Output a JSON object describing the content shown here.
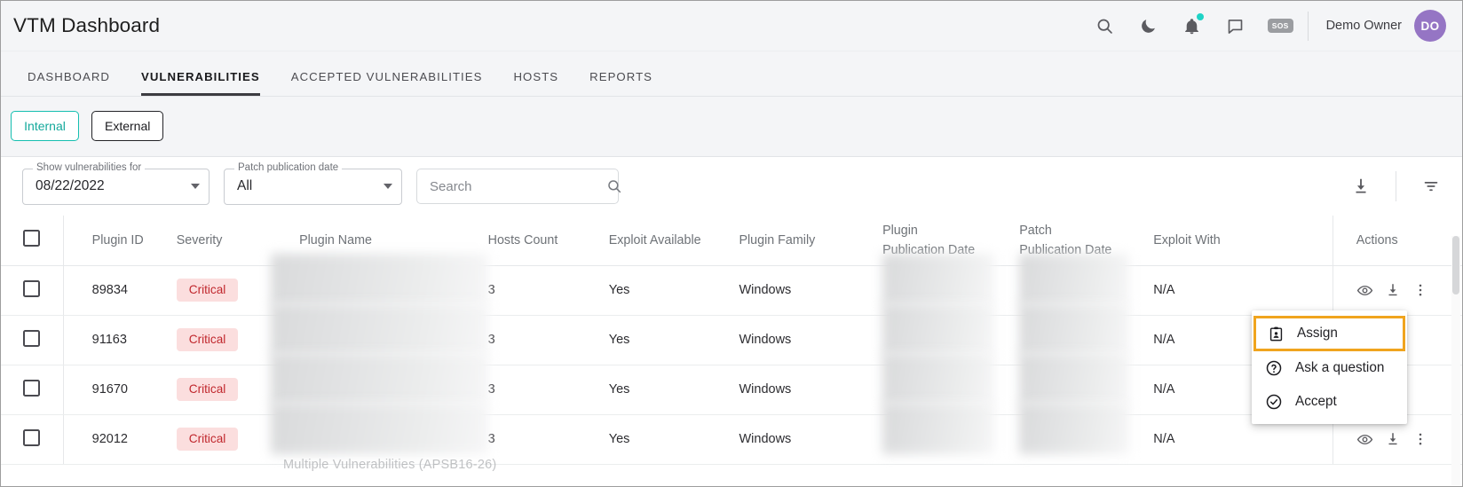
{
  "header": {
    "title": "VTM Dashboard",
    "icons": [
      {
        "name": "search-icon"
      },
      {
        "name": "dark-mode-moon-icon"
      },
      {
        "name": "notifications-bell-icon",
        "badge": true
      },
      {
        "name": "chat-message-icon"
      },
      {
        "name": "sos-icon",
        "label": "SOS"
      }
    ],
    "user_name": "Demo Owner",
    "avatar_initials": "DO",
    "accent_teal": "#1ed3c6",
    "avatar_color": "#9575c4"
  },
  "tabs": [
    {
      "label": "DASHBOARD",
      "active": false
    },
    {
      "label": "VULNERABILITIES",
      "active": true
    },
    {
      "label": "ACCEPTED VULNERABILITIES",
      "active": false
    },
    {
      "label": "HOSTS",
      "active": false
    },
    {
      "label": "REPORTS",
      "active": false
    }
  ],
  "scope": {
    "selected": "Internal",
    "buttons": [
      {
        "label": "Internal",
        "selected": true
      },
      {
        "label": "External",
        "selected": false
      }
    ],
    "selected_color": "#15a99c"
  },
  "filters": {
    "date_filter": {
      "label": "Show vulnerabilities for",
      "value": "08/22/2022"
    },
    "patch_filter": {
      "label": "Patch publication date",
      "value": "All"
    },
    "search": {
      "placeholder": "Search",
      "value": ""
    },
    "download_label": "download-icon",
    "filter_label": "filter-icon"
  },
  "table": {
    "columns": [
      {
        "key": "check",
        "label": ""
      },
      {
        "key": "plugin_id",
        "label": "Plugin ID"
      },
      {
        "key": "severity",
        "label": "Severity"
      },
      {
        "key": "plugin_name",
        "label": "Plugin Name"
      },
      {
        "key": "hosts_count",
        "label": "Hosts Count"
      },
      {
        "key": "exploit_available",
        "label": "Exploit Available"
      },
      {
        "key": "plugin_family",
        "label": "Plugin Family"
      },
      {
        "key": "plugin_pub_date",
        "label_line1": "Plugin",
        "label_line2": "Publication Date"
      },
      {
        "key": "patch_pub_date",
        "label_line1": "Patch",
        "label_line2": "Publication Date"
      },
      {
        "key": "exploit_with",
        "label": "Exploit With"
      },
      {
        "key": "actions",
        "label": "Actions"
      }
    ],
    "rows": [
      {
        "plugin_id": "89834",
        "severity": "Critical",
        "plugin_name": "",
        "hosts_count": "3",
        "exploit_available": "Yes",
        "plugin_family": "Windows",
        "plugin_pub_date": "",
        "patch_pub_date": "",
        "exploit_with": "N/A"
      },
      {
        "plugin_id": "91163",
        "severity": "Critical",
        "plugin_name": "",
        "hosts_count": "3",
        "exploit_available": "Yes",
        "plugin_family": "Windows",
        "plugin_pub_date": "",
        "patch_pub_date": "",
        "exploit_with": "N/A"
      },
      {
        "plugin_id": "91670",
        "severity": "Critical",
        "plugin_name": "",
        "hosts_count": "3",
        "exploit_available": "Yes",
        "plugin_family": "Windows",
        "plugin_pub_date": "",
        "patch_pub_date": "",
        "exploit_with": "N/A"
      },
      {
        "plugin_id": "92012",
        "severity": "Critical",
        "plugin_name": "",
        "hosts_count": "3",
        "exploit_available": "Yes",
        "plugin_family": "Windows",
        "plugin_pub_date": "",
        "patch_pub_date": "",
        "exploit_with": "N/A"
      }
    ],
    "severity_pill_bg": "#fbdede",
    "severity_pill_fg": "#c0272d",
    "clipped_row_text": "Multiple Vulnerabilities (APSB16-26)"
  },
  "context_menu": {
    "highlight_color": "#f0a41e",
    "items": [
      {
        "label": "Assign",
        "icon": "assign-badge-icon",
        "highlighted": true
      },
      {
        "label": "Ask a question",
        "icon": "question-circle-icon",
        "highlighted": false
      },
      {
        "label": "Accept",
        "icon": "check-circle-icon",
        "highlighted": false
      }
    ]
  }
}
